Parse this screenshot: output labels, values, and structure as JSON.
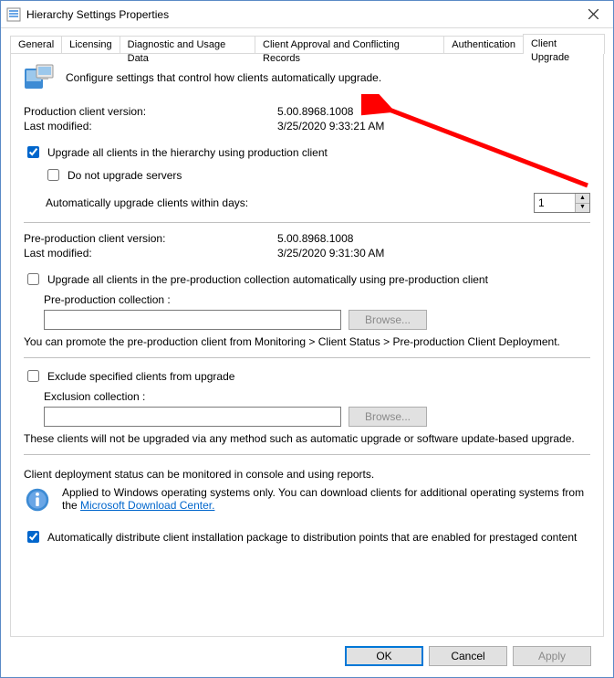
{
  "window": {
    "title": "Hierarchy Settings Properties"
  },
  "tabs": {
    "general": "General",
    "licensing": "Licensing",
    "diagnostic": "Diagnostic and Usage Data",
    "client_approval": "Client Approval and Conflicting Records",
    "authentication": "Authentication",
    "client_upgrade": "Client Upgrade"
  },
  "intro": "Configure settings that control how clients automatically upgrade.",
  "prod": {
    "version_label": "Production client version:",
    "version_value": "5.00.8968.1008",
    "modified_label": "Last modified:",
    "modified_value": "3/25/2020 9:33:21 AM"
  },
  "upgrade_all": {
    "label": "Upgrade all clients in the hierarchy using production client",
    "do_not_upgrade_servers": "Do not upgrade servers",
    "auto_within_days_label": "Automatically upgrade clients within days:",
    "days_value": "1"
  },
  "preprod": {
    "version_label": "Pre-production client version:",
    "version_value": "5.00.8968.1008",
    "modified_label": "Last modified:",
    "modified_value": "3/25/2020 9:31:30 AM",
    "upgrade_label": "Upgrade all clients in the pre-production collection automatically using pre-production client",
    "collection_label": "Pre-production collection :",
    "browse": "Browse...",
    "promote_text": "You can promote the pre-production client from Monitoring > Client Status > Pre-production Client Deployment."
  },
  "exclude": {
    "label": "Exclude specified clients from upgrade",
    "collection_label": "Exclusion collection :",
    "browse": "Browse...",
    "note": "These clients will not be upgraded via any method such as automatic upgrade or software update-based upgrade."
  },
  "status_text": "Client deployment status can be monitored in console and using reports.",
  "applied": {
    "text_prefix": "Applied to Windows operating systems only. You can download clients for additional operating systems from the ",
    "link": "Microsoft Download Center."
  },
  "auto_distribute": "Automatically distribute client installation package to distribution points that are enabled for prestaged content",
  "buttons": {
    "ok": "OK",
    "cancel": "Cancel",
    "apply": "Apply"
  }
}
